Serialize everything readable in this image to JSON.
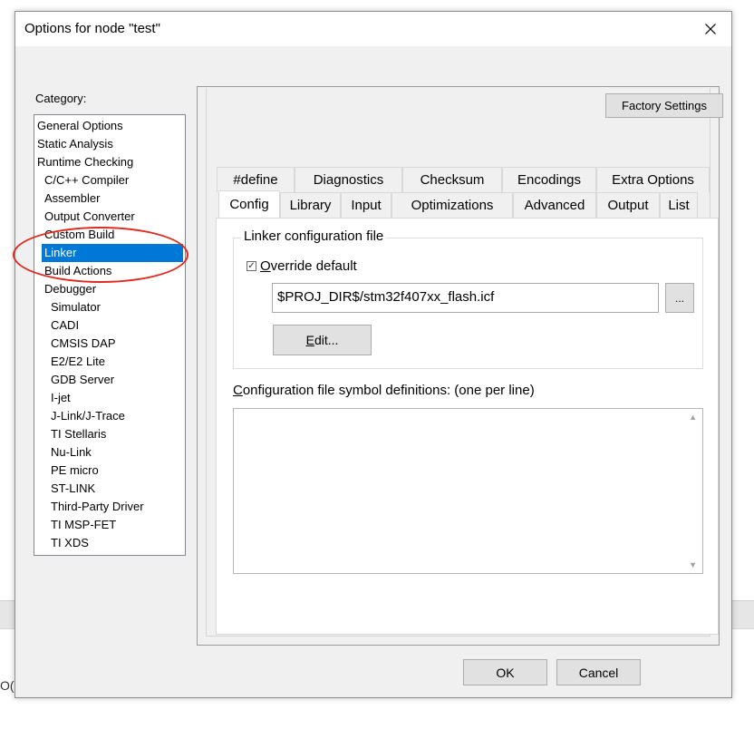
{
  "background": {
    "partial_text": "O("
  },
  "dialog": {
    "title": "Options for node \"test\"",
    "close_icon": "close-icon"
  },
  "category": {
    "label": "Category:",
    "items": [
      {
        "label": "General Options",
        "level": 0
      },
      {
        "label": "Static Analysis",
        "level": 0
      },
      {
        "label": "Runtime Checking",
        "level": 0
      },
      {
        "label": "C/C++ Compiler",
        "level": 1
      },
      {
        "label": "Assembler",
        "level": 1
      },
      {
        "label": "Output Converter",
        "level": 1
      },
      {
        "label": "Custom Build",
        "level": 1
      },
      {
        "label": "Linker",
        "level": 1,
        "selected": true
      },
      {
        "label": "Build Actions",
        "level": 1
      },
      {
        "label": "Debugger",
        "level": 1
      },
      {
        "label": "Simulator",
        "level": 2
      },
      {
        "label": "CADI",
        "level": 2
      },
      {
        "label": "CMSIS DAP",
        "level": 2
      },
      {
        "label": "E2/E2 Lite",
        "level": 2
      },
      {
        "label": "GDB Server",
        "level": 2
      },
      {
        "label": "I-jet",
        "level": 2
      },
      {
        "label": "J-Link/J-Trace",
        "level": 2
      },
      {
        "label": "TI Stellaris",
        "level": 2
      },
      {
        "label": "Nu-Link",
        "level": 2
      },
      {
        "label": "PE micro",
        "level": 2
      },
      {
        "label": "ST-LINK",
        "level": 2
      },
      {
        "label": "Third-Party Driver",
        "level": 2
      },
      {
        "label": "TI MSP-FET",
        "level": 2
      },
      {
        "label": "TI XDS",
        "level": 2
      }
    ],
    "selected_color": "#0078d7",
    "annotation_color": "#e0291f"
  },
  "toolbar": {
    "factory_settings": "Factory Settings"
  },
  "tabs": {
    "row1": [
      "#define",
      "Diagnostics",
      "Checksum",
      "Encodings",
      "Extra Options"
    ],
    "row2": [
      "Config",
      "Library",
      "Input",
      "Optimizations",
      "Advanced",
      "Output",
      "List"
    ],
    "active": "Config"
  },
  "config": {
    "group_title": "Linker configuration file",
    "override_prefix": "O",
    "override_rest": "verride default",
    "override_checked": true,
    "path_value": "$PROJ_DIR$/stm32f407xx_flash.icf",
    "browse_label": "...",
    "edit_prefix": "E",
    "edit_rest": "dit...",
    "defs_prefix": "C",
    "defs_rest": "onfiguration file symbol definitions: (one per line)",
    "defs_value": ""
  },
  "footer": {
    "ok": "OK",
    "cancel": "Cancel"
  }
}
